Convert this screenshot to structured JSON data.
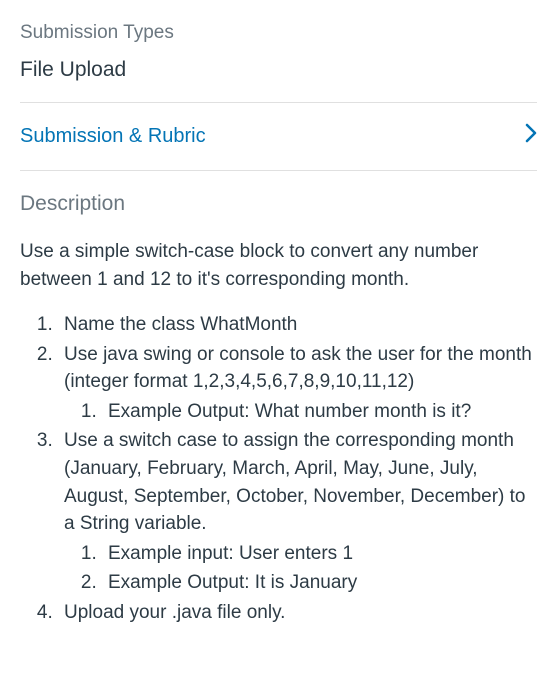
{
  "submissionTypes": {
    "label": "Submission Types",
    "value": "File Upload"
  },
  "submissionRubric": {
    "label": "Submission & Rubric"
  },
  "description": {
    "heading": "Description",
    "intro": "Use a simple switch-case block to convert any number between 1 and 12 to it's corresponding month.",
    "items": [
      {
        "text": "Name the class WhatMonth"
      },
      {
        "text": "Use java swing or console to ask the user for the month (integer format 1,2,3,4,5,6,7,8,9,10,11,12)",
        "sub": [
          "Example Output: What number month is it?"
        ]
      },
      {
        "text": "Use a switch case to assign  the corresponding month (January, February, March, April, May, June, July, August, September, October, November, December) to a String variable.",
        "sub": [
          "Example input: User enters 1",
          "Example Output: It is January"
        ]
      },
      {
        "text": "Upload your .java file only."
      }
    ]
  }
}
